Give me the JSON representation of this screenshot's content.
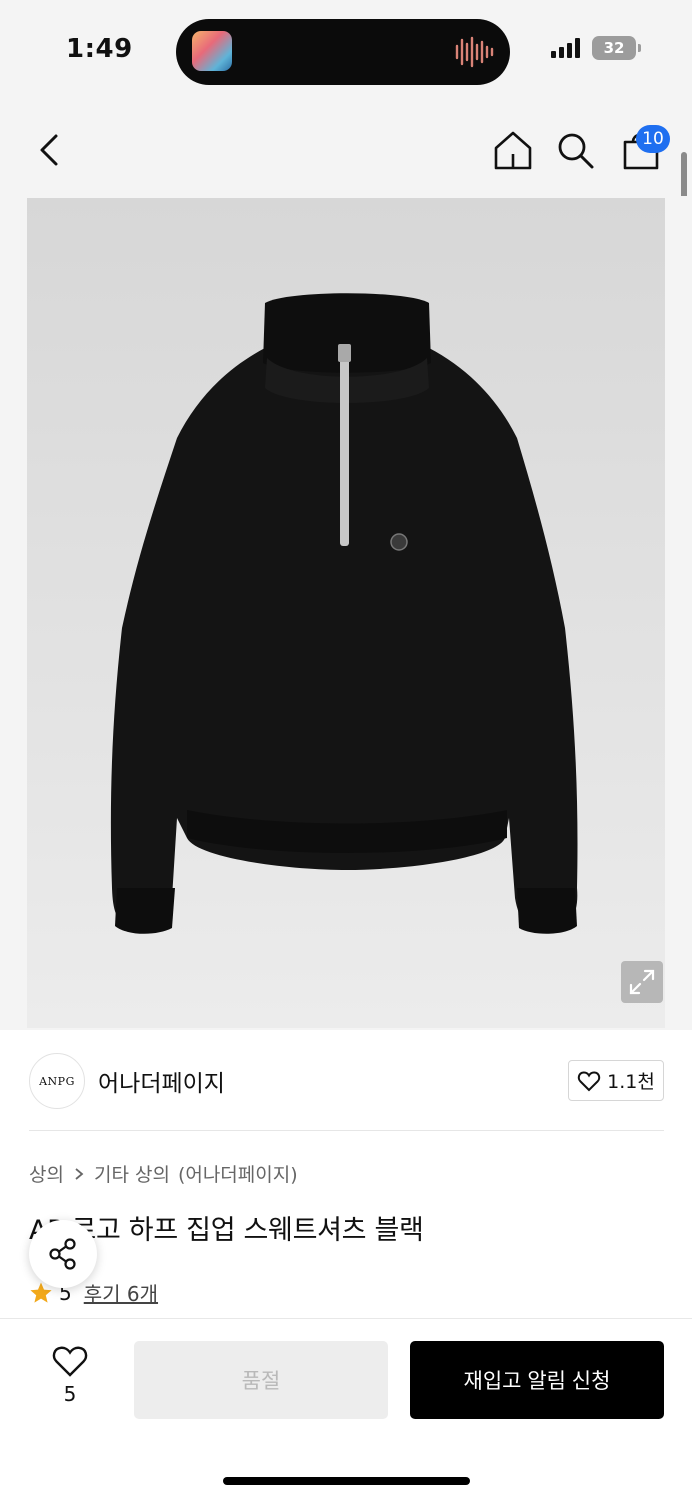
{
  "status_bar": {
    "time": "1:49",
    "battery": "32",
    "icons": [
      "app-icon",
      "audio-wave-icon",
      "signal-icon",
      "wifi-icon",
      "battery-icon"
    ]
  },
  "header": {
    "icons": [
      "back-arrow-icon",
      "home-icon",
      "search-icon",
      "shopping-bag-icon"
    ],
    "cart_count": "10"
  },
  "product_image": {
    "expand_icon": "expand-icon"
  },
  "brand": {
    "logo_text": "ANPG",
    "name": "어나더페이지",
    "like_count": "1.1천"
  },
  "product": {
    "breadcrumb": [
      "상의",
      "기타 상의",
      "(어나더페이지)"
    ],
    "title": "AP 로고 하프 집업 스웨트셔츠 블랙",
    "rating": "5",
    "review_label": "후기 6개"
  },
  "bottom_bar": {
    "wish_count": "5",
    "soldout_label": "품절",
    "restock_label": "재입고 알림 신청"
  },
  "colors": {
    "accent_blue": "#1f6ff0",
    "star": "#f2a91b",
    "cta": "#000000"
  }
}
